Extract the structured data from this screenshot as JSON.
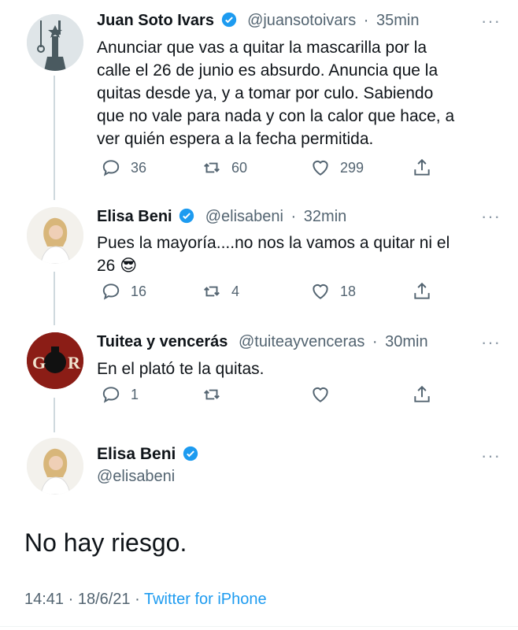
{
  "tweets": [
    {
      "name": "Juan Soto Ivars",
      "handle": "@juansotoivars",
      "time": "35min",
      "text": "Anunciar que vas a quitar la mascarilla por la\ncalle el 26 de junio es absurdo. Anuncia que la\nquitas desde ya, y a tomar por culo. Sabiendo\nque no vale para nada y con la calor que hace, a\nver quién espera a la fecha permitida.",
      "replies": "36",
      "retweets": "60",
      "likes": "299"
    },
    {
      "name": "Elisa Beni",
      "handle": "@elisabeni",
      "time": "32min",
      "text": "Pues la mayoría....no nos la vamos a quitar ni el\n26 😎",
      "replies": "16",
      "retweets": "4",
      "likes": "18"
    },
    {
      "name": "Tuitea y vencerás",
      "handle": "@tuiteayvenceras",
      "time": "30min",
      "text": "En el plató te la quitas.",
      "replies": "1",
      "retweets": "",
      "likes": ""
    }
  ],
  "focus": {
    "name": "Elisa Beni",
    "handle": "@elisabeni",
    "text": "No hay riesgo.",
    "timestamp": "14:41 · 18/6/21 ·",
    "source": "Twitter for iPhone"
  },
  "ui": {
    "separator": "·",
    "more": "···",
    "avatar_initials": "G R"
  },
  "colors": {
    "verified": "#1d9bf0",
    "muted": "#536471",
    "link": "#1d9bf0"
  },
  "icons": [
    "reply-icon",
    "retweet-icon",
    "like-icon",
    "share-icon",
    "verified-icon",
    "more-icon"
  ]
}
